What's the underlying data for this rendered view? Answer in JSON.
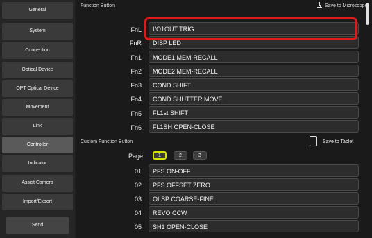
{
  "sidebar": {
    "items": [
      {
        "label": "General"
      },
      {
        "label": "System"
      },
      {
        "label": "Connection"
      },
      {
        "label": "Optical Device"
      },
      {
        "label": "OPT Optical Device"
      },
      {
        "label": "Movement"
      },
      {
        "label": "Link"
      },
      {
        "label": "Controller"
      },
      {
        "label": "Indicator"
      },
      {
        "label": "Assist Camera"
      },
      {
        "label": "Import/Export"
      }
    ],
    "active": "Controller",
    "send_label": "Send"
  },
  "function_button": {
    "title": "Function Button",
    "save_label": "Save to Microscope",
    "rows": [
      {
        "key": "FnL",
        "value": "I/O1OUT TRIG"
      },
      {
        "key": "FnR",
        "value": "DISP LED"
      },
      {
        "key": "Fn1",
        "value": "MODE1 MEM-RECALL"
      },
      {
        "key": "Fn2",
        "value": "MODE2 MEM-RECALL"
      },
      {
        "key": "Fn3",
        "value": "COND SHIFT"
      },
      {
        "key": "Fn4",
        "value": "COND SHUTTER MOVE"
      },
      {
        "key": "Fn5",
        "value": "FL1st SHIFT"
      },
      {
        "key": "Fn6",
        "value": "FL1SH OPEN-CLOSE"
      }
    ]
  },
  "custom_function_button": {
    "title": "Custom Function Button",
    "save_label": "Save to Tablet",
    "page_label": "Page",
    "pages": [
      "1",
      "2",
      "3"
    ],
    "active_page": "1",
    "rows": [
      {
        "key": "01",
        "value": "PFS ON-OFF"
      },
      {
        "key": "02",
        "value": "PFS OFFSET ZERO"
      },
      {
        "key": "03",
        "value": "OLSP COARSE-FINE"
      },
      {
        "key": "04",
        "value": "REVO CCW"
      },
      {
        "key": "05",
        "value": "SH1 OPEN-CLOSE"
      }
    ]
  },
  "colors": {
    "highlight": "#e01a1a",
    "active_page_border": "#d8e000"
  }
}
